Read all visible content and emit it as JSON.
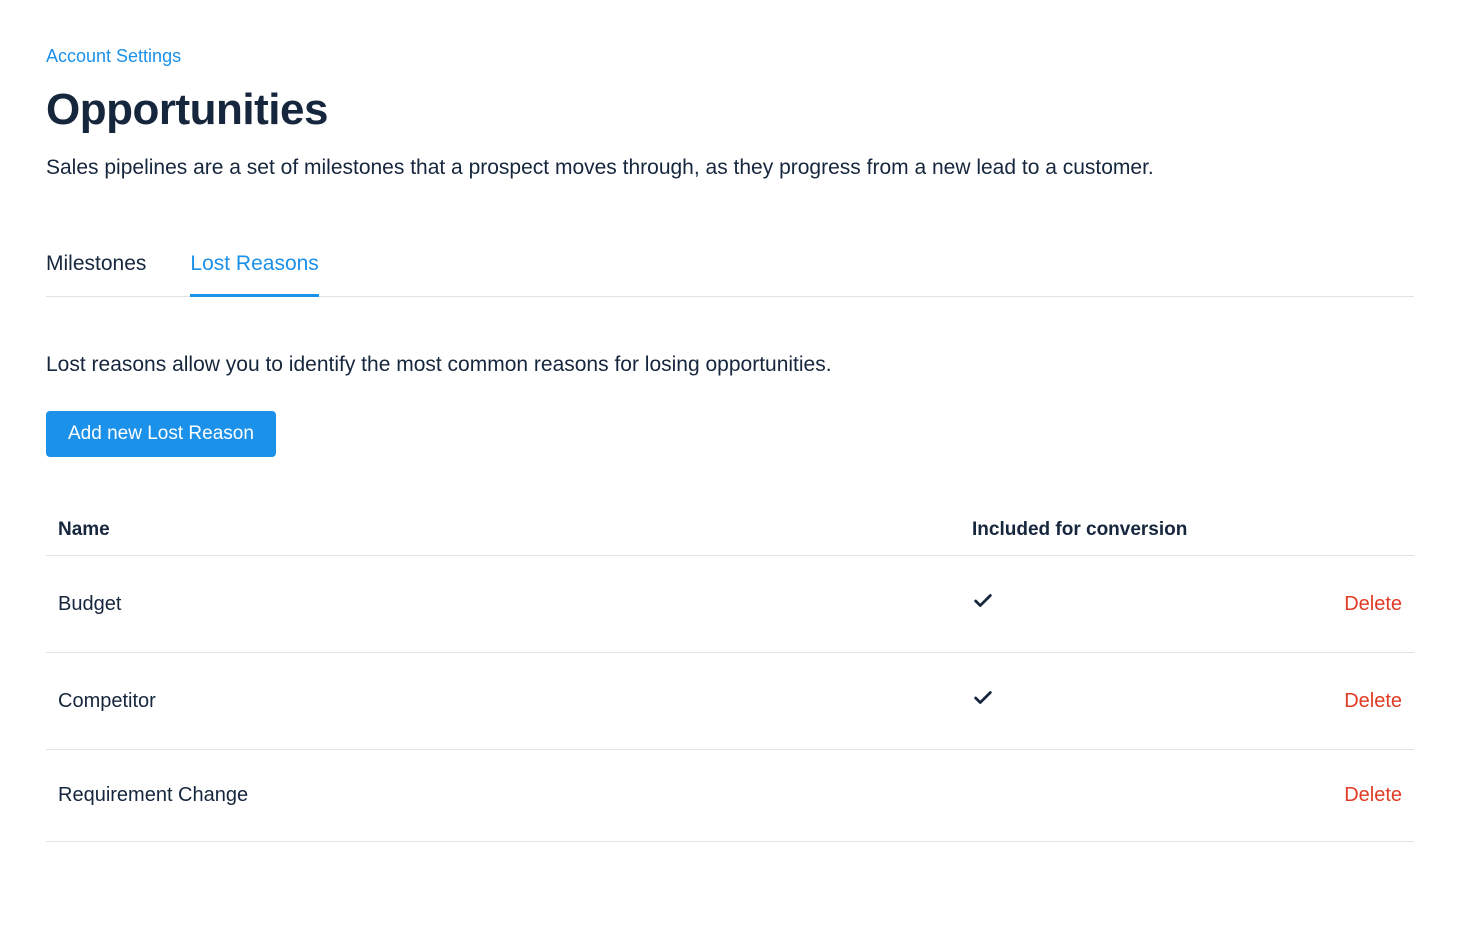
{
  "breadcrumb": "Account Settings",
  "page": {
    "title": "Opportunities",
    "description": "Sales pipelines are a set of milestones that a prospect moves through, as they progress from a new lead to a customer."
  },
  "tabs": [
    {
      "label": "Milestones",
      "active": false
    },
    {
      "label": "Lost Reasons",
      "active": true
    }
  ],
  "lostReasons": {
    "description": "Lost reasons allow you to identify the most common reasons for losing opportunities.",
    "addButtonLabel": "Add new Lost Reason",
    "columns": {
      "name": "Name",
      "conversion": "Included for conversion"
    },
    "deleteLabel": "Delete",
    "rows": [
      {
        "name": "Budget",
        "includedForConversion": true
      },
      {
        "name": "Competitor",
        "includedForConversion": true
      },
      {
        "name": "Requirement Change",
        "includedForConversion": false
      }
    ]
  }
}
